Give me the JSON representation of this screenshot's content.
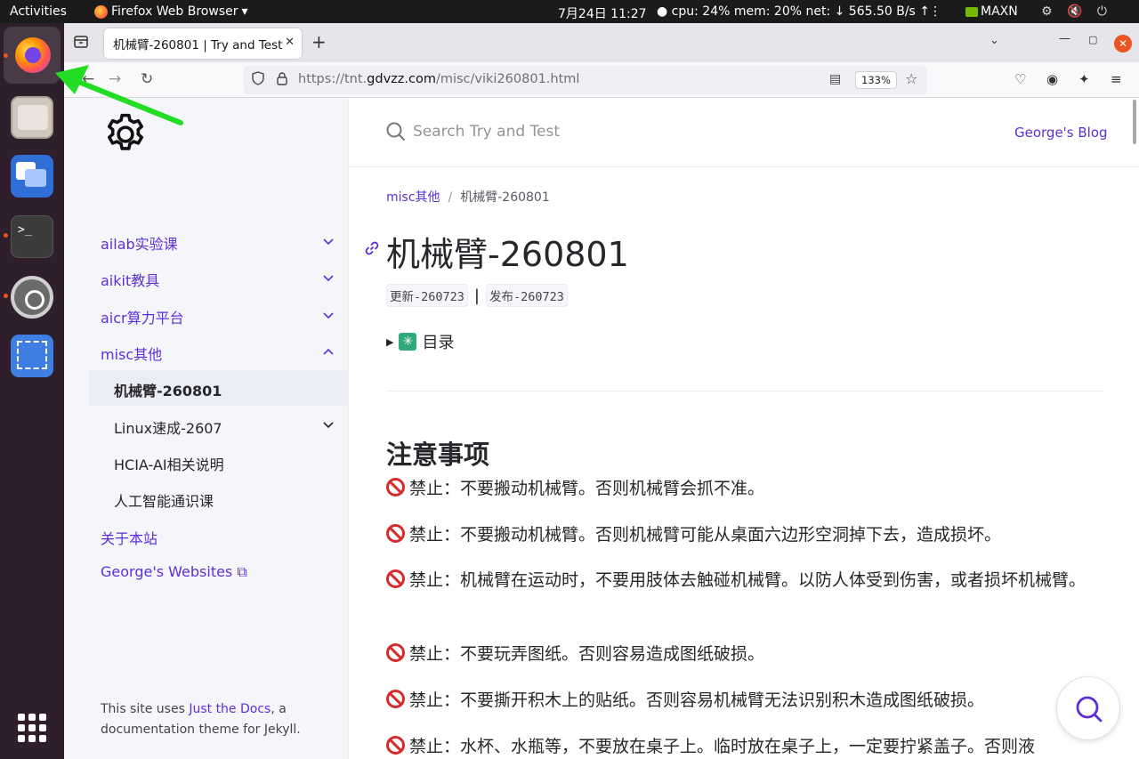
{
  "topbar": {
    "activities": "Activities",
    "app_name": "Firefox Web Browser",
    "app_menu_arrow": "▾",
    "datetime": "7月24日 11:27",
    "stats": "● cpu: 24% mem: 20% net: ↓ 565.50 B/s ↑",
    "overflow": "⋮",
    "nvidia_label": "MAXN",
    "system_icons": "⚙ 🔇 ⏻"
  },
  "dock": {
    "apps": [
      "firefox-icon",
      "files-icon",
      "remmina-icon",
      "terminal-icon",
      "settings-icon",
      "screenshot-icon"
    ],
    "terminal_glyph": ">_"
  },
  "browser": {
    "tab_title": "机械臂-260801 | Try and Test",
    "tab_close": "✕",
    "new_tab": "+",
    "tab_list": "⌄",
    "win_min": "—",
    "win_max": "▢",
    "win_close": "✕",
    "nav_back": "←",
    "nav_fwd": "→",
    "nav_reload": "↻",
    "url_prefix": "https://tnt.",
    "url_domain": "gdvzz.com",
    "url_path": "/misc/viki260801.html",
    "zoom": "133%",
    "reader": "▤",
    "star": "☆",
    "pocket": "♡",
    "account": "◉",
    "extensions": "✦",
    "menu": "≡"
  },
  "sidebar": {
    "items": [
      {
        "label": "ailab实验课"
      },
      {
        "label": "aikit教具"
      },
      {
        "label": "aicr算力平台"
      },
      {
        "label": "misc其他"
      }
    ],
    "subitems": [
      {
        "label": "机械臂-260801"
      },
      {
        "label": "Linux速成-2607"
      },
      {
        "label": "HCIA-AI相关说明"
      },
      {
        "label": "人工智能通识课"
      }
    ],
    "about": "关于本站",
    "websites": "George's Websites",
    "external_icon": "⧉",
    "footer_pre": "This site uses ",
    "footer_link": "Just the Docs",
    "footer_post": ", a documentation theme for Jekyll."
  },
  "main": {
    "search_placeholder": "Search Try and Test",
    "blog_link": "George's Blog",
    "breadcrumb_parent": "misc其他",
    "breadcrumb_sep": "/",
    "breadcrumb_current": "机械臂-260801",
    "title": "机械臂-260801",
    "badge_updated": "更新-260723",
    "badge_sep": "|",
    "badge_published": "发布-260723",
    "toc_triangle": "▶",
    "toc_star": "✳",
    "toc_label": "目录",
    "section_title": "注意事项",
    "rules": [
      "禁止：不要搬动机械臂。否则机械臂会抓不准。",
      "禁止：不要搬动机械臂。否则机械臂可能从桌面六边形空洞掉下去，造成损坏。",
      "禁止：机械臂在运动时，不要用肢体去触碰机械臂。以防人体受到伤害，或者损坏机械臂。",
      "禁止：不要玩弄图纸。否则容易造成图纸破损。",
      "禁止：不要撕开积木上的贴纸。否则容易机械臂无法识别积木造成图纸破损。",
      "禁止：水杯、水瓶等，不要放在桌子上。临时放在桌子上，一定要拧紧盖子。否则液"
    ]
  },
  "colors": {
    "link": "#5c2fd6",
    "ban": "#d62b2b",
    "annotation_arrow": "#22dd22",
    "ubuntu_orange": "#e95420"
  }
}
